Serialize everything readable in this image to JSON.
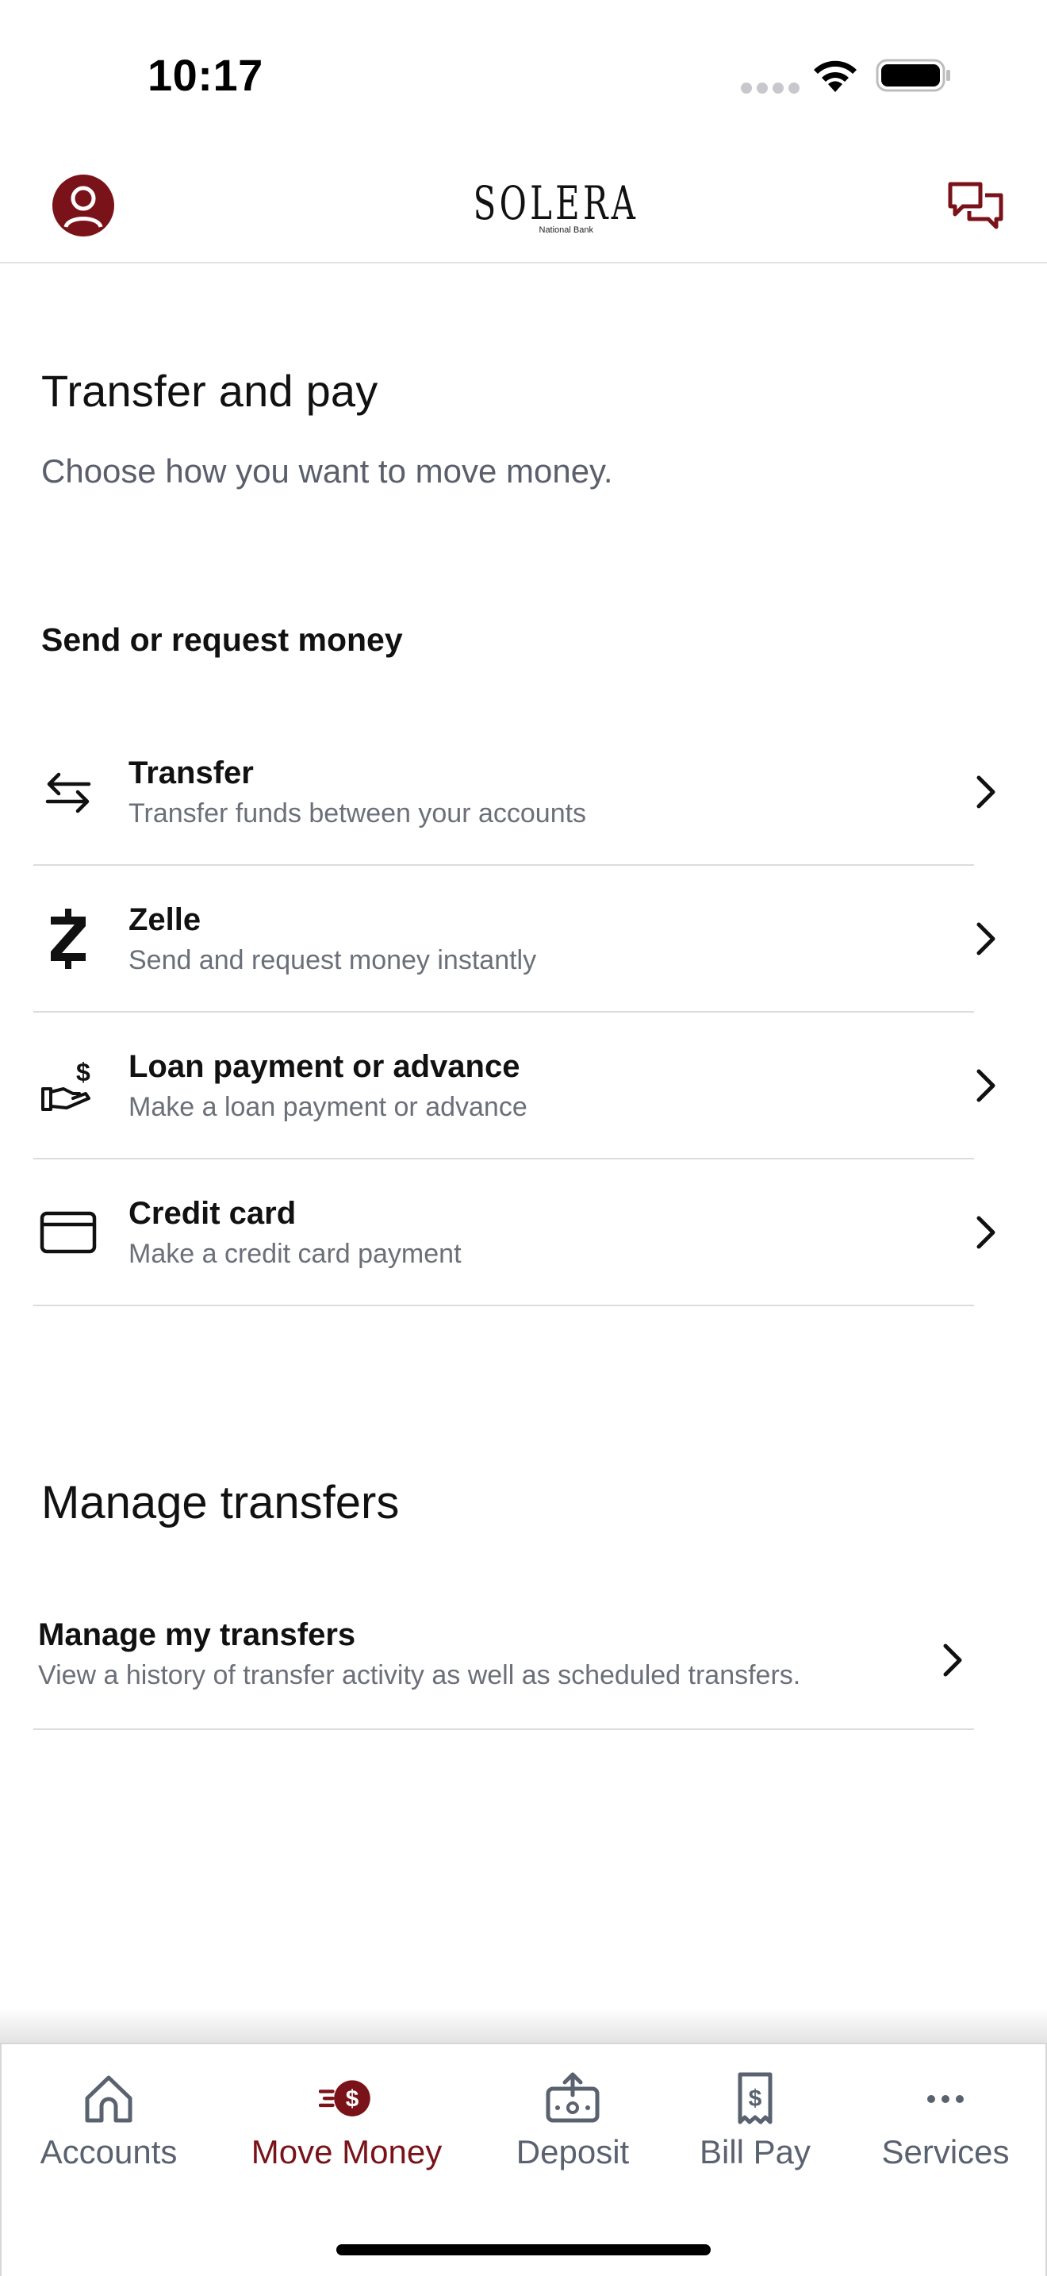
{
  "status_bar": {
    "time": "10:17"
  },
  "header": {
    "logo_text": "SOLERA",
    "logo_subtext": "National Bank",
    "profile_icon": "user-circle-icon",
    "chat_icon": "chat-bubbles-icon"
  },
  "page": {
    "title": "Transfer and pay",
    "subtitle": "Choose how you want to move money."
  },
  "send_section": {
    "title": "Send or request money",
    "items": [
      {
        "label": "Transfer",
        "description": "Transfer funds between your accounts",
        "icon": "arrows-swap-icon"
      },
      {
        "label": "Zelle",
        "description": "Send and request money instantly",
        "icon": "zelle-icon"
      },
      {
        "label": "Loan payment or advance",
        "description": "Make a loan payment or advance",
        "icon": "hand-dollar-icon"
      },
      {
        "label": "Credit card",
        "description": "Make a credit card payment",
        "icon": "credit-card-icon"
      }
    ]
  },
  "manage_section": {
    "title": "Manage transfers",
    "item": {
      "label": "Manage my transfers",
      "description": "View a history of transfer activity as well as scheduled transfers."
    }
  },
  "tab_bar": {
    "tabs": [
      {
        "label": "Accounts",
        "icon": "home-icon",
        "active": false
      },
      {
        "label": "Move Money",
        "icon": "move-money-icon",
        "active": true
      },
      {
        "label": "Deposit",
        "icon": "deposit-icon",
        "active": false
      },
      {
        "label": "Bill Pay",
        "icon": "bill-icon",
        "active": false
      },
      {
        "label": "Services",
        "icon": "more-dots-icon",
        "active": false
      }
    ]
  },
  "colors": {
    "brand": "#7a1319",
    "text_primary": "#111111",
    "text_secondary": "#6b6f78",
    "tab_inactive": "#5a6270"
  }
}
